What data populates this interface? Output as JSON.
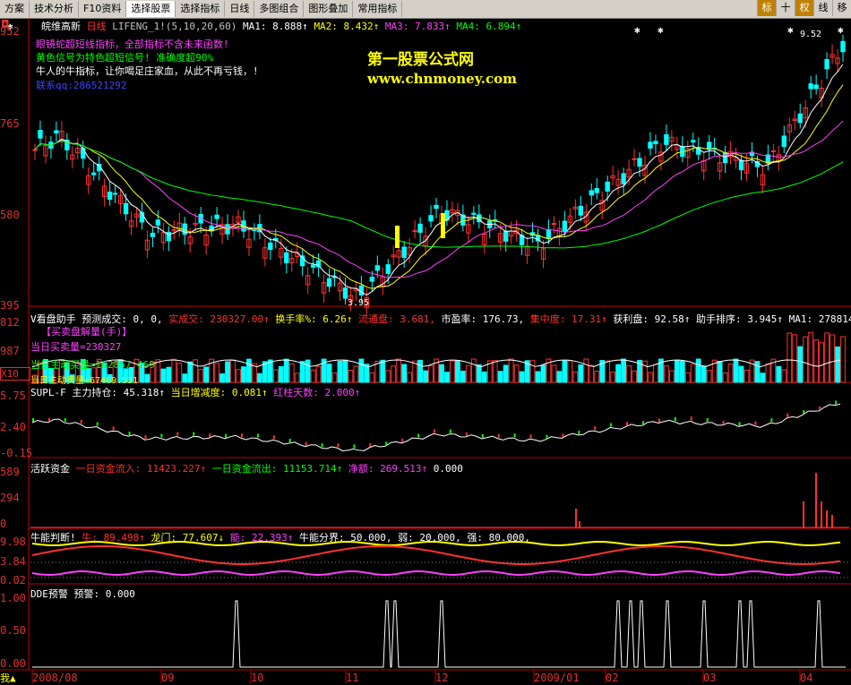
{
  "menu": {
    "items": [
      "方案",
      "技术分析",
      "F10资料",
      "选择股票",
      "选择指标",
      "日线",
      "多图组合",
      "图形叠加",
      "常用指标"
    ],
    "selected_index": 3,
    "right_buttons": [
      "标",
      "十",
      "权",
      "线",
      "移"
    ]
  },
  "colors": {
    "bg": "#000000",
    "up": "#ff3030",
    "down": "#00ffff",
    "ma1": "#ffffff",
    "ma2": "#ffff00",
    "ma3": "#ff40ff",
    "ma4": "#00ff00",
    "axis": "#c00000"
  },
  "main": {
    "stock_name": "皖维高新",
    "period": "日线",
    "indicator": "LIFENG_1!(5,10,20,60)",
    "ma1": "MA1: 8.888↑",
    "ma2": "MA2: 8.432↑",
    "ma3": "MA3: 7.833↑",
    "ma4": "MA4: 6.894↑",
    "notes": [
      "眼镜蛇超短线指标，全部指标不含未来函数!",
      "黄色信号为特色超短信号! 准确度超90%",
      "牛人的牛指标，让你喝足庄家血，从此不再亏钱，!",
      "联系qq:286521292"
    ],
    "watermark_title": "第一股票公式网",
    "watermark_url": "www.chnmoney.com",
    "y_ticks": [
      "952",
      "765",
      "580",
      "395"
    ],
    "high_label": "9.52",
    "low_label": "3.95",
    "b_label": "B"
  },
  "vol": {
    "title": "V看盘助手",
    "fields": "预测成交: 0, 0,",
    "real": "实成交: 230327.00↑",
    "turnover": "换手率%: 6.26↑",
    "float": "流通盘: 3.681,",
    "pe": "市盈率: 176.73,",
    "conc": "集中度: 17.31↑",
    "profit": "获利盘: 92.58↑",
    "rank": "助手排序: 3.945↑",
    "ma1": "MA1: 278814.",
    "line1": "【买卖盘解量(手)】",
    "line2": "当日买卖量=230327",
    "line3": "当日主动买量=162857.469",
    "line4": "当日主动卖量=67469.531",
    "y_ticks": [
      "812",
      "987",
      "X10"
    ]
  },
  "supl": {
    "title": "SUPL-F",
    "hold": "主力持仓: 45.318↑",
    "inc": "当日增减度: 0.081↑",
    "red": "红柱天数: 2.000↑",
    "y_ticks": [
      "5.75",
      "2.40",
      "-0.15"
    ]
  },
  "active": {
    "title": "活跃资金",
    "inflow": "一日资金流入: 11423.227↑",
    "outflow": "一日资金流出: 11153.714↑",
    "net": "净额: 269.513↑",
    "zero": "0.000",
    "y_ticks": [
      "589",
      "294",
      "0"
    ]
  },
  "bull": {
    "title": "牛能判断!",
    "bull": "牛: 89.498↑",
    "dragon": "龙门: 77.607↓",
    "energy": "能: 22.393↑",
    "split": "牛能分界: 50.000,",
    "weak": "弱: 20.000,",
    "strong": "强: 80.000,",
    "y_ticks": [
      "9.98",
      "3.84",
      "0.02"
    ]
  },
  "dde": {
    "title": "DDE预警",
    "warn": "预警: 0.000",
    "y_ticks": [
      "1.00",
      "0.50",
      "0.00"
    ]
  },
  "dates": [
    "2008/08",
    "09",
    "10",
    "11",
    "12",
    "2009/01",
    "02",
    "03",
    "04"
  ],
  "corner": "我"
}
